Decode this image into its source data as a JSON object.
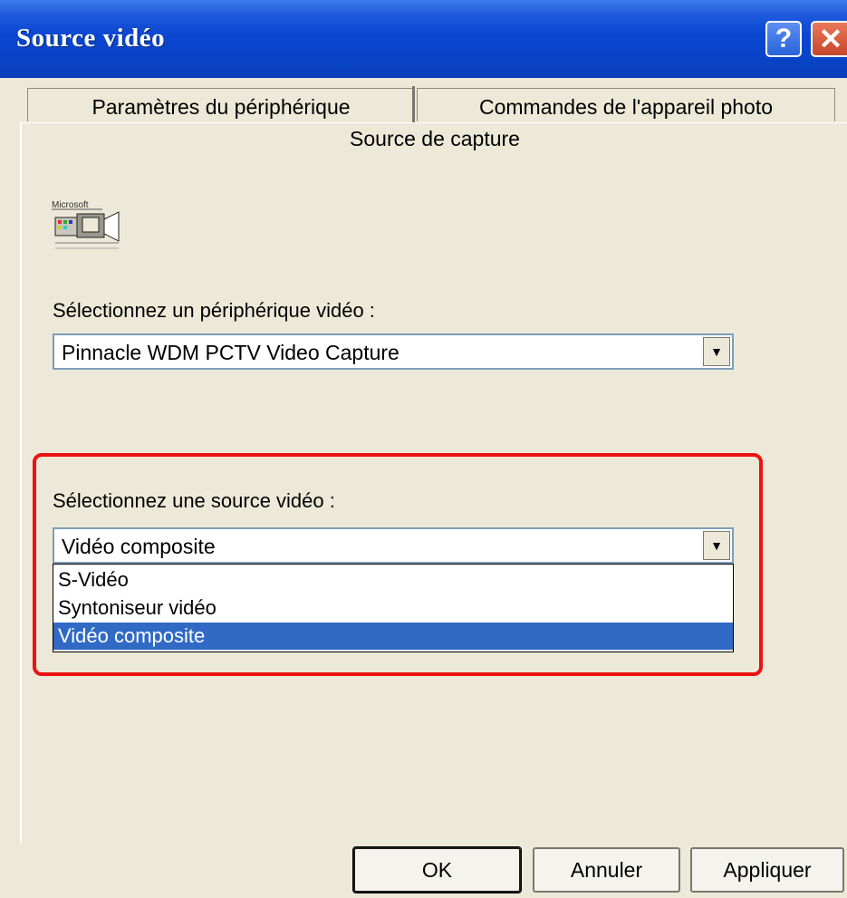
{
  "window": {
    "title": "Source vidéo",
    "help_glyph": "?",
    "close_glyph": "✕"
  },
  "tabs": [
    {
      "label": "Paramètres du périphérique"
    },
    {
      "label": "Commandes de l'appareil photo"
    },
    {
      "label": "Source de capture",
      "active": true
    }
  ],
  "logo": {
    "text": "Microsoft",
    "icon": "video-camera-icon"
  },
  "device": {
    "label": "Sélectionnez un périphérique vidéo :",
    "value": "Pinnacle WDM PCTV Video Capture"
  },
  "source": {
    "label": "Sélectionnez une source vidéo :",
    "value": "Vidéo composite",
    "options": [
      "S-Vidéo",
      "Syntoniseur vidéo",
      "Vidéo composite"
    ],
    "selected_index": 2
  },
  "buttons": {
    "ok": "OK",
    "cancel": "Annuler",
    "apply": "Appliquer"
  },
  "colors": {
    "titlebar": "#0843c8",
    "highlight_border": "#ee1111",
    "selection": "#316ac5"
  }
}
